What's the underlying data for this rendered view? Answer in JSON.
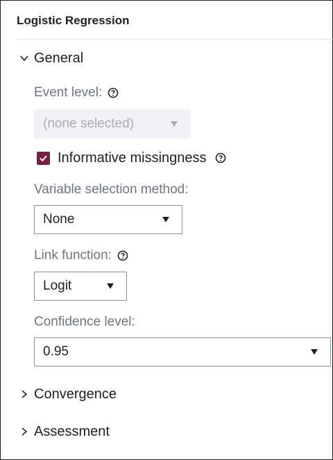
{
  "panel": {
    "title": "Logistic Regression"
  },
  "sections": {
    "general": {
      "label": "General",
      "expanded": true
    },
    "convergence": {
      "label": "Convergence",
      "expanded": false
    },
    "assessment": {
      "label": "Assessment",
      "expanded": false
    }
  },
  "general": {
    "event_level": {
      "label": "Event level:",
      "value": "(none selected)",
      "disabled": true
    },
    "informative_missingness": {
      "label": "Informative missingness",
      "checked": true
    },
    "variable_selection": {
      "label": "Variable selection method:",
      "value": "None"
    },
    "link_function": {
      "label": "Link function:",
      "value": "Logit"
    },
    "confidence_level": {
      "label": "Confidence level:",
      "value": "0.95"
    }
  },
  "colors": {
    "accent": "#7b1d3f",
    "label_gray": "#6b7682",
    "border": "#8a8f96",
    "disabled_bg": "#f1f2f3"
  }
}
